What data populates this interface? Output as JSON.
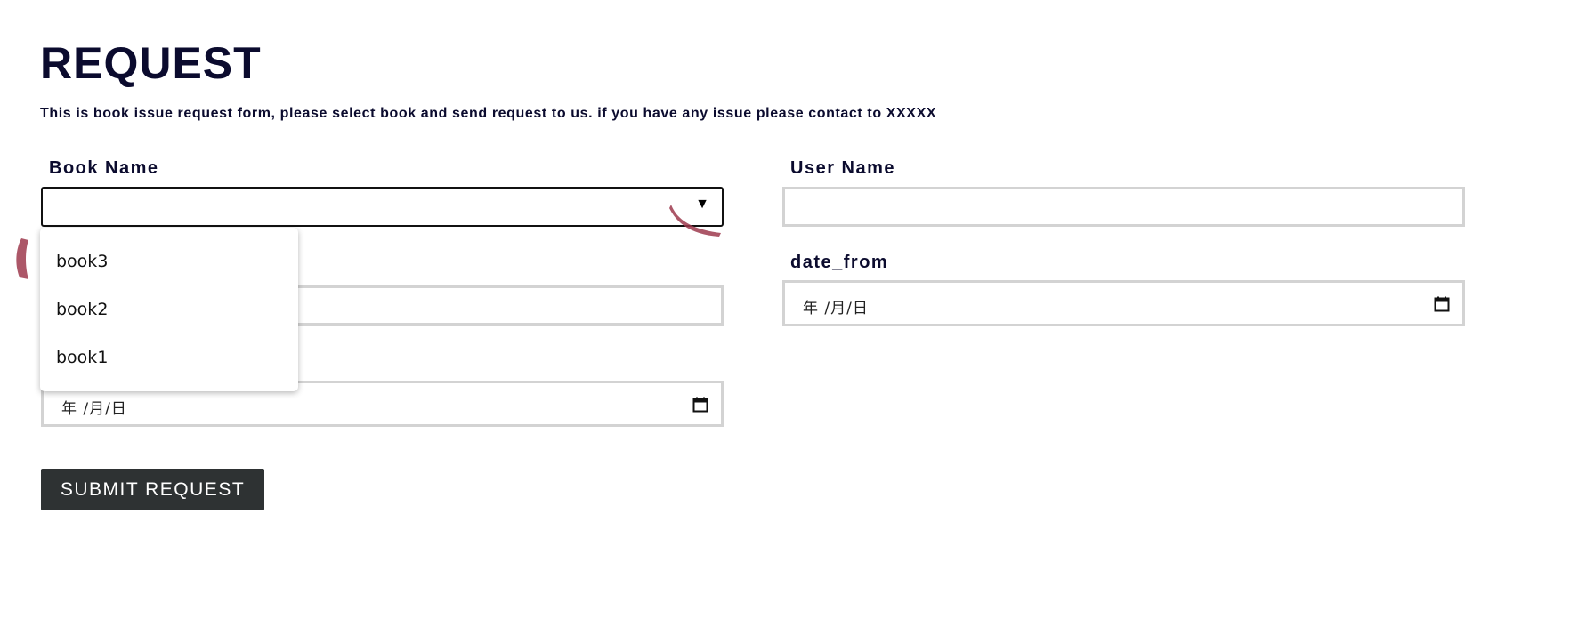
{
  "page": {
    "title": "REQUEST",
    "description": "This is book issue request form, please select book and send request to us. if you have any issue please contact to XXXXX"
  },
  "form": {
    "book_name": {
      "label": "Book Name",
      "value": "",
      "options": [
        "book3",
        "book2",
        "book1"
      ]
    },
    "user_name": {
      "label": "User Name",
      "value": ""
    },
    "date_from": {
      "label": "date_from",
      "placeholder": "年 /月/日"
    },
    "left_text_field": {
      "value": ""
    },
    "left_date_field": {
      "placeholder": "年 /月/日"
    },
    "submit_label": "SUBMIT REQUEST"
  },
  "icons": {
    "dropdown_caret": "▼",
    "calendar": "calendar-icon"
  }
}
